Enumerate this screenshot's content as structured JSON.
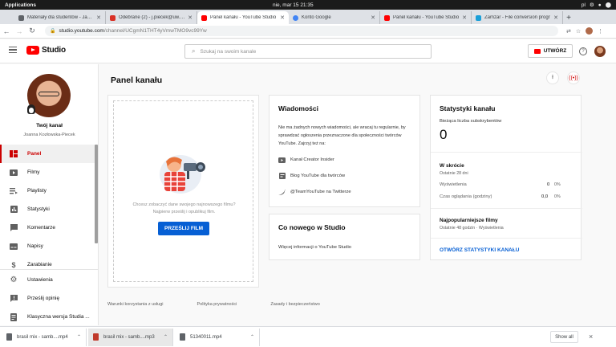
{
  "os": {
    "apps_label": "Applications",
    "clock": "nie, mar 15   21:35",
    "tray": [
      "pl",
      "⚙",
      "●",
      "⬤"
    ]
  },
  "browser": {
    "tabs": [
      {
        "label": "Materiały dla studentów - Jan ko",
        "color": "#5f6368",
        "active": false
      },
      {
        "label": "Odebrane (2) - j.piecek@uw.edu",
        "color": "#d93025",
        "active": false
      },
      {
        "label": "Panel kanału - YouTube Studio",
        "color": "#ff0000",
        "active": true
      },
      {
        "label": "Konto Google",
        "color": "#4285f4",
        "active": false
      },
      {
        "label": "Panel kanału - YouTube Studio",
        "color": "#ff0000",
        "active": false
      },
      {
        "label": "Zamzar - File conversion progr",
        "color": "#1a9fd8",
        "active": false
      }
    ],
    "new_tab": "+",
    "url_host": "studio.youtube.com",
    "url_path": "/channel/UCgmN1THT4yVmwTMO9vc99Yw"
  },
  "header": {
    "studio_label": "Studio",
    "search_placeholder": "Szukaj na swoim kanale",
    "create_label": "UTWÓRZ",
    "help": "?"
  },
  "sidebar": {
    "channel_title": "Twój kanał",
    "channel_owner": "Joanna Kozłowska-Piecek",
    "items": [
      {
        "label": "Panel",
        "icon": "dashboard-icon",
        "active": true
      },
      {
        "label": "Filmy",
        "icon": "video-icon",
        "active": false
      },
      {
        "label": "Playlisty",
        "icon": "playlist-icon",
        "active": false
      },
      {
        "label": "Statystyki",
        "icon": "analytics-icon",
        "active": false
      },
      {
        "label": "Komentarze",
        "icon": "comments-icon",
        "active": false
      },
      {
        "label": "Napisy",
        "icon": "subtitles-icon",
        "active": false
      },
      {
        "label": "Zarabianie",
        "icon": "monetization-icon",
        "active": false
      }
    ],
    "bottom_items": [
      {
        "label": "Ustawienia",
        "icon": "gear-icon"
      },
      {
        "label": "Prześlij opinię",
        "icon": "feedback-icon"
      },
      {
        "label": "Klasyczna wersja Studia ...",
        "icon": "classic-studio-icon"
      }
    ]
  },
  "main": {
    "page_title": "Panel kanału",
    "upload_card": {
      "text_line1": "Chcesz zobaczyć dane swojego najnowszego filmu?",
      "text_line2": "Najpierw prześlij i opublikuj film.",
      "button": "PRZEŚLIJ FILM"
    },
    "news_card": {
      "title": "Wiadomości",
      "body": "Nie ma żadnych nowych wiadomości, ale wracaj tu regularnie, by sprawdzać ogłoszenia przeznaczone dla społeczności twórców YouTube. Zajrzyj też na:",
      "links": [
        {
          "label": "Kanał Creator Insider",
          "icon": "youtube-icon"
        },
        {
          "label": "Blog YouTube dla twórców",
          "icon": "blog-icon"
        },
        {
          "label": "@TeamYouTube na Twitterze",
          "icon": "twitter-icon"
        }
      ]
    },
    "whats_new_card": {
      "title": "Co nowego w Studio",
      "link": "Więcej informacji o YouTube Studio"
    },
    "stats_card": {
      "title": "Statystyki kanału",
      "subs_label": "Bieżąca liczba subskrybentów",
      "subs_value": "0",
      "summary_title": "W skrócie",
      "summary_period": "Ostatnie 28 dni",
      "rows": [
        {
          "label": "Wyświetlenia",
          "value": "0",
          "pct": "0%"
        },
        {
          "label": "Czas oglądania (godziny)",
          "value": "0,0",
          "pct": "0%"
        }
      ],
      "top_title": "Najpopularniejsze filmy",
      "top_period": "Ostatnie 48 godzin · Wyświetlenia",
      "link": "OTWÓRZ STATYSTYKI KANAŁU"
    },
    "footer": [
      "Warunki korzystania z usługi",
      "Polityka prywatności",
      "Zasady i bezpieczeństwo"
    ]
  },
  "downloads": {
    "items": [
      {
        "label": "brasil mix - samb....mp4",
        "highlight": false
      },
      {
        "label": "brasil mix - samb....mp3",
        "highlight": true
      },
      {
        "label": "51340011.mp4",
        "highlight": false
      }
    ],
    "show_all": "Show all",
    "close": "×"
  },
  "colors": {
    "accent_red": "#cc0000",
    "link_blue": "#065fd4",
    "youtube_red": "#ff0000"
  }
}
